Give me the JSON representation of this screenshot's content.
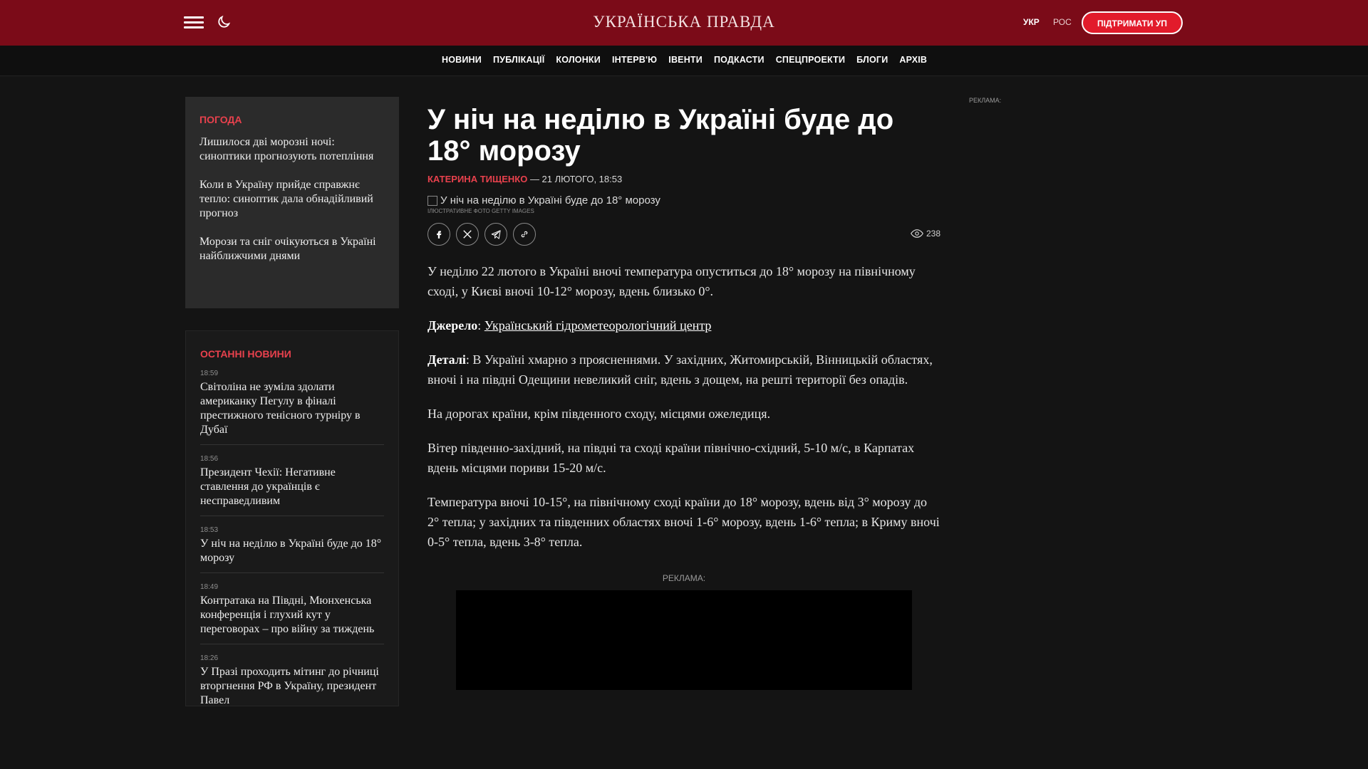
{
  "header": {
    "logo": "УКРАЇНСЬКА ПРАВДА",
    "lang_ukr": "УКР",
    "lang_ros": "РОС",
    "support_button": "ПІДТРИМАТИ УП"
  },
  "nav": {
    "items": [
      "НОВИНИ",
      "ПУБЛІКАЦІЇ",
      "КОЛОНКИ",
      "ІНТЕРВ'Ю",
      "ІВЕНТИ",
      "ПОДКАСТИ",
      "СПЕЦПРОЕКТИ",
      "БЛОГИ",
      "АРХІВ"
    ]
  },
  "weather": {
    "heading": "ПОГОДА",
    "items": [
      "Лишилося дві морозні ночі: синоптики прогнозують потепління",
      "Коли в Україну прийде справжнє тепло: синоптик дала обнадійливий прогноз",
      "Морози та сніг очікуються в Україні найближчими днями"
    ]
  },
  "latest": {
    "heading": "ОСТАННІ НОВИНИ",
    "items": [
      {
        "time": "18:59",
        "title": "Світоліна не зуміла здолати американку Пегулу в фіналі престижного тенісного турніру в Дубаї"
      },
      {
        "time": "18:56",
        "title": "Президент Чехії: Негативне ставлення до українців є несправедливим"
      },
      {
        "time": "18:53",
        "title": "У ніч на неділю в Україні буде до 18° морозу"
      },
      {
        "time": "18:49",
        "title": "Контратака на Півдні, Мюнхенська конференція і глухий кут у переговорах – про війну за тиждень"
      },
      {
        "time": "18:26",
        "title": "У Празі проходить мітинг до річниці вторгнення РФ в Україну, президент Павел"
      }
    ]
  },
  "article": {
    "title": "У ніч на неділю в Україні буде до 18° морозу",
    "author": "КАТЕРИНА ТИЩЕНКО",
    "date": " — 21 ЛЮТОГО, 18:53",
    "image_alt": "У ніч на неділю в Україні буде до 18° морозу",
    "image_credit": "ІЛЮСТРАТИВНЕ ФОТО GETTY IMAGES",
    "views": "238",
    "p1": "У неділю 22 лютого в Україні вночі температура опуститься до 18° морозу на північному сході, у Києві вночі 10-12° морозу, вдень близько 0°.",
    "source_label": "Джерело",
    "source_sep": ": ",
    "source_link": "Український гідрометеорологічний центр",
    "details_label": "Деталі",
    "details_text": ": В Україні хмарно з проясненнями. У західних, Житомирській, Вінницькій областях, вночі і на півдні Одещини невеликий сніг, вдень з дощем, на решті території без опадів.",
    "p3": "На дорогах країни, крім південного сходу, місцями ожеледиця.",
    "p4": "Вітер південно-західний, на півдні та сході країни північно-східний, 5-10 м/с, в Карпатах вдень місцями пориви 15-20 м/с.",
    "p5": "Температура вночі 10-15°, на північному сході країни до 18° морозу, вдень від 3° морозу до 2° тепла; у західних та південних областях вночі 1-6° морозу, вдень 1-6° тепла; в Криму вночі 0-5° тепла, вдень 3-8° тепла.",
    "ad_label": "РЕКЛАМА:"
  },
  "right_ad": {
    "label": "РЕКЛАМА:"
  }
}
